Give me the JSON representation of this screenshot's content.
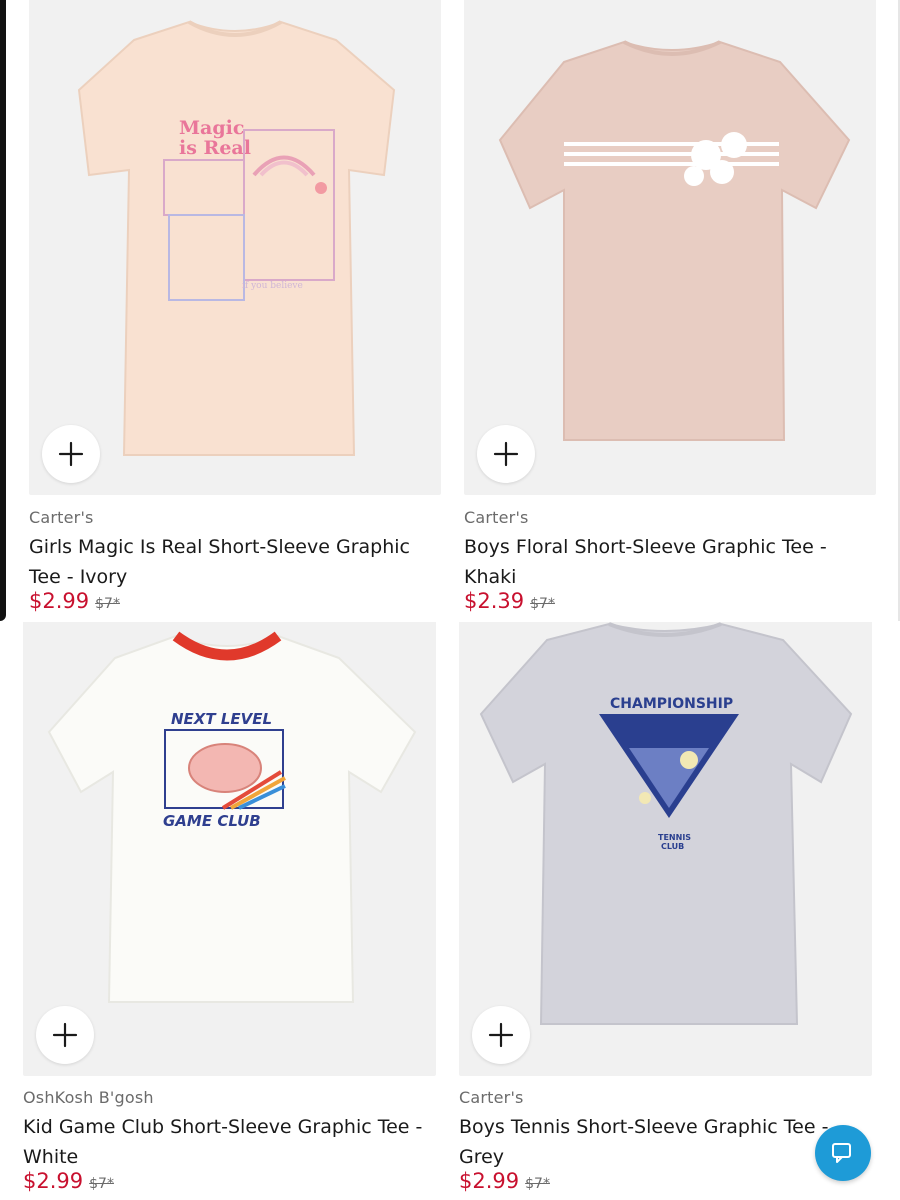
{
  "colors": {
    "sale_price": "#c8102e",
    "chat_button": "#1e9bd7",
    "image_bg": "#f1f1f1"
  },
  "icons": {
    "add": "plus-icon",
    "chat": "chat-bubble-icon"
  },
  "products": [
    {
      "brand": "Carter's",
      "title": "Girls Magic Is Real Short-Sleeve Graphic Tee - Ivory",
      "price": "$2.99",
      "was_price": "$7*",
      "graphic_text": {
        "line1": "Magic",
        "line2": "is Real",
        "small": "if you believe"
      }
    },
    {
      "brand": "Carter's",
      "title": "Boys Floral Short-Sleeve Graphic Tee - Khaki",
      "price": "$2.39",
      "was_price": "$7*"
    },
    {
      "brand": "OshKosh B'gosh",
      "title": "Kid Game Club Short-Sleeve Graphic Tee - White",
      "price": "$2.99",
      "was_price": "$7*",
      "graphic_text": {
        "line1": "NEXT LEVEL",
        "line2": "GAME CLUB"
      }
    },
    {
      "brand": "Carter's",
      "title": "Boys Tennis Short-Sleeve Graphic Tee - Grey",
      "price": "$2.99",
      "was_price": "$7*",
      "graphic_text": {
        "line1": "CHAMPIONSHIP",
        "line2": "TENNIS",
        "line3": "CLUB"
      }
    }
  ]
}
